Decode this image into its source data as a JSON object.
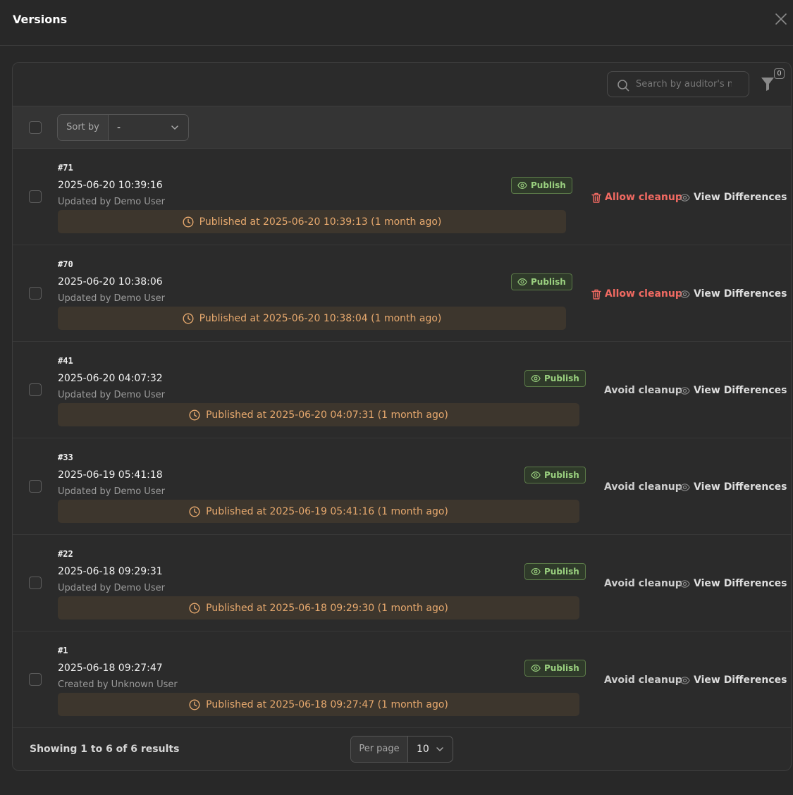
{
  "modal": {
    "title": "Versions"
  },
  "toolbar": {
    "search_placeholder": "Search by auditor's n",
    "filter_count": "0"
  },
  "sort": {
    "label": "Sort by",
    "value": "-"
  },
  "colors": {
    "allow_cleanup": "#f16a62",
    "publish_badge": "#9ad07f",
    "published_text": "#e7a96e"
  },
  "versions": [
    {
      "id": "#71",
      "date": "2025-06-20 10:39:16",
      "updated_by": "Updated by Demo User",
      "badge": "Publish",
      "published_text": "Published at 2025-06-20 10:39:13 (1 month ago)",
      "cleanup_label": "Allow cleanup",
      "cleanup_type": "allow",
      "diff_label": "View Differences"
    },
    {
      "id": "#70",
      "date": "2025-06-20 10:38:06",
      "updated_by": "Updated by Demo User",
      "badge": "Publish",
      "published_text": "Published at 2025-06-20 10:38:04 (1 month ago)",
      "cleanup_label": "Allow cleanup",
      "cleanup_type": "allow",
      "diff_label": "View Differences"
    },
    {
      "id": "#41",
      "date": "2025-06-20 04:07:32",
      "updated_by": "Updated by Demo User",
      "badge": "Publish",
      "published_text": "Published at 2025-06-20 04:07:31 (1 month ago)",
      "cleanup_label": "Avoid cleanup",
      "cleanup_type": "avoid",
      "diff_label": "View Differences"
    },
    {
      "id": "#33",
      "date": "2025-06-19 05:41:18",
      "updated_by": "Updated by Demo User",
      "badge": "Publish",
      "published_text": "Published at 2025-06-19 05:41:16 (1 month ago)",
      "cleanup_label": "Avoid cleanup",
      "cleanup_type": "avoid",
      "diff_label": "View Differences"
    },
    {
      "id": "#22",
      "date": "2025-06-18 09:29:31",
      "updated_by": "Updated by Demo User",
      "badge": "Publish",
      "published_text": "Published at 2025-06-18 09:29:30 (1 month ago)",
      "cleanup_label": "Avoid cleanup",
      "cleanup_type": "avoid",
      "diff_label": "View Differences"
    },
    {
      "id": "#1",
      "date": "2025-06-18 09:27:47",
      "updated_by": "Created by Unknown User",
      "badge": "Publish",
      "published_text": "Published at 2025-06-18 09:27:47 (1 month ago)",
      "cleanup_label": "Avoid cleanup",
      "cleanup_type": "avoid",
      "diff_label": "View Differences"
    }
  ],
  "footer": {
    "showing": "Showing 1 to 6 of 6 results",
    "per_page_label": "Per page",
    "per_page_value": "10"
  }
}
